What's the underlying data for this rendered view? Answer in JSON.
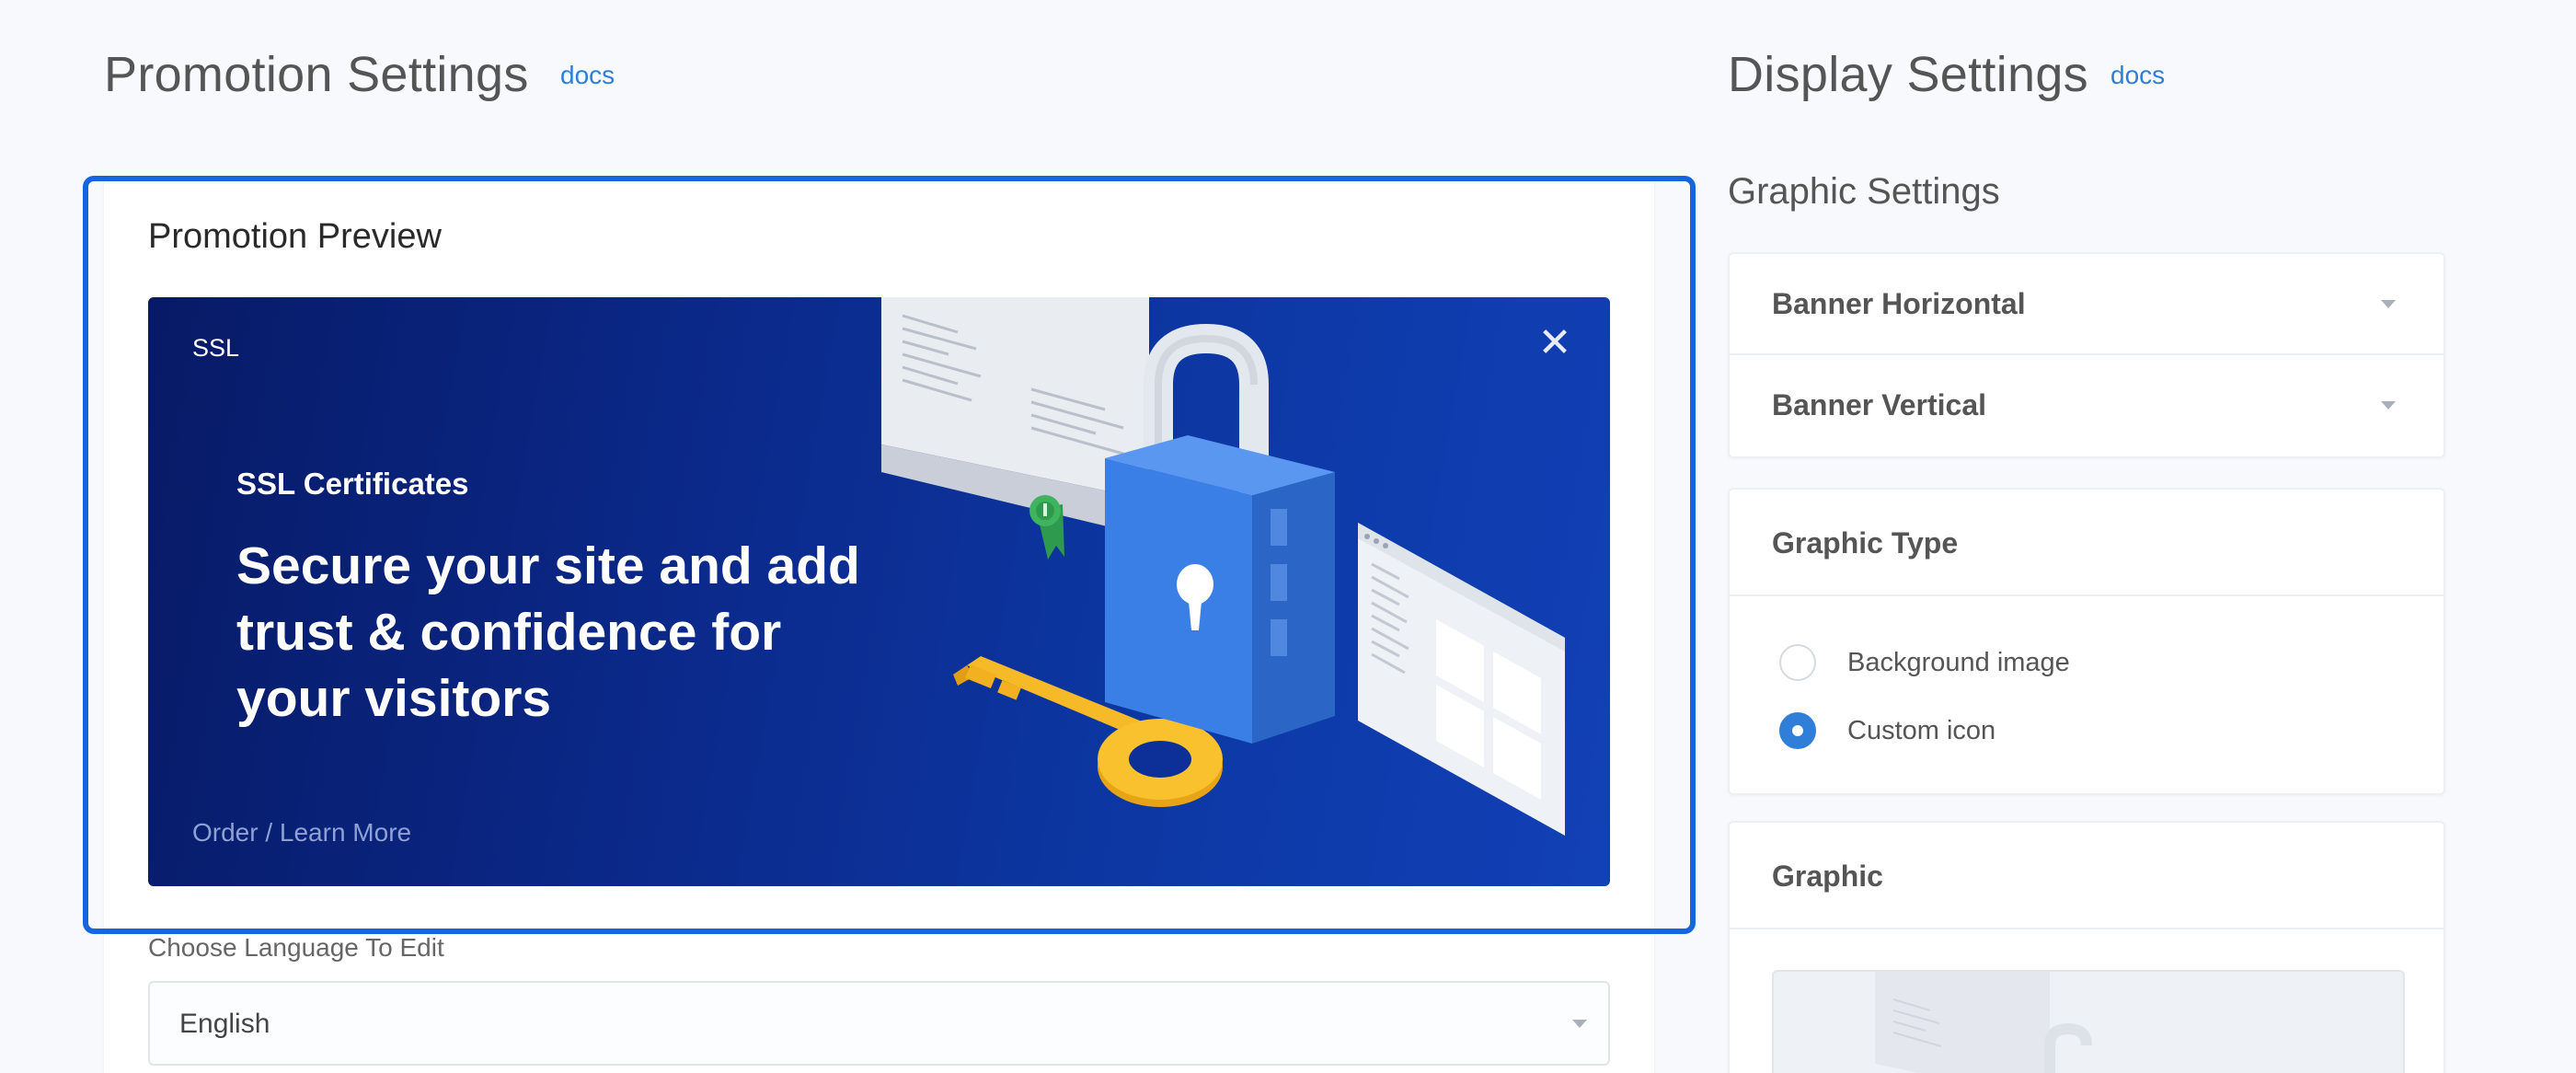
{
  "promotion": {
    "title": "Promotion Settings",
    "docs_label": "docs",
    "preview_title": "Promotion Preview",
    "banner": {
      "tag": "SSL",
      "close_symbol": "✕",
      "subtitle": "SSL Certificates",
      "headline": "Secure your site and add trust & confidence for your visitors",
      "link": "Order / Learn More"
    },
    "language": {
      "label": "Choose Language To Edit",
      "value": "English"
    }
  },
  "display": {
    "title": "Display Settings",
    "docs_label": "docs",
    "graphic_settings_title": "Graphic Settings",
    "layout_items": [
      "Banner Horizontal",
      "Banner Vertical"
    ],
    "graphic_type": {
      "title": "Graphic Type",
      "options": [
        "Background image",
        "Custom icon"
      ],
      "selected": "Custom icon"
    },
    "graphic": {
      "title": "Graphic"
    }
  },
  "colors": {
    "accent": "#2f7ed8",
    "highlight": "#1565e0",
    "banner_dark": "#071a66",
    "banner_light": "#1240b6",
    "key": "#f6b928"
  },
  "icons": [
    "close-icon",
    "chevron-down-icon",
    "padlock-icon",
    "key-icon",
    "certificate-icon",
    "browser-window-icon",
    "ribbon-icon"
  ]
}
